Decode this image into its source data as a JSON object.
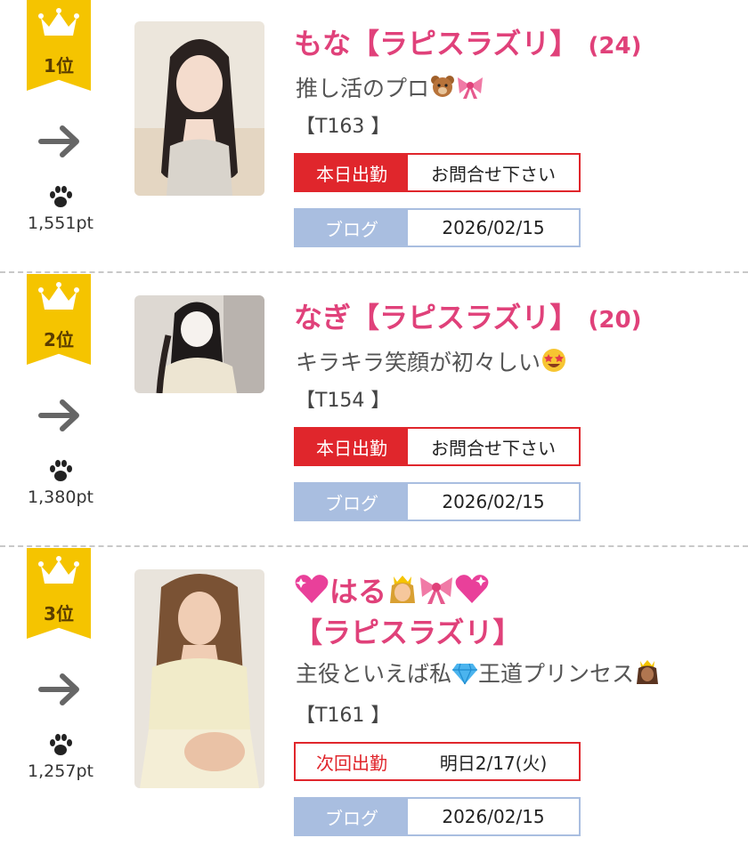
{
  "ranking": [
    {
      "rank_label": "1位",
      "points": "1,551pt",
      "name": "もな【ラピスラズリ】",
      "age": "(24)",
      "catchphrase": "推し活のプロ",
      "height": "【T163 】",
      "work_label": "本日出勤",
      "work_value": "お問合せ下さい",
      "blog_label": "ブログ",
      "blog_date": "2026/02/15"
    },
    {
      "rank_label": "2位",
      "points": "1,380pt",
      "name": "なぎ【ラピスラズリ】",
      "age": "(20)",
      "catchphrase": "キラキラ笑顔が初々しい",
      "height": "【T154 】",
      "work_label": "本日出勤",
      "work_value": "お問合せ下さい",
      "blog_label": "ブログ",
      "blog_date": "2026/02/15"
    },
    {
      "rank_label": "3位",
      "points": "1,257pt",
      "name_main": "はる",
      "name_shop": "【ラピスラズリ】",
      "catchphrase": "主役といえば私",
      "catchphrase_tail": "王道プリンセス",
      "height": "【T161 】",
      "work_label": "次回出勤",
      "work_value": "明日2/17(火)",
      "blog_label": "ブログ",
      "blog_date": "2026/02/15"
    }
  ],
  "colors": {
    "badge": "#f5c400",
    "name": "#e0417a",
    "work_today": "#e0262c",
    "blog": "#a9bee0"
  },
  "icons": [
    "crown-icon",
    "trend-arrow-icon",
    "paw-icon",
    "bear-emoji",
    "ribbon-emoji",
    "star-eyes-emoji",
    "sparkling-heart-emoji",
    "princess-emoji",
    "gem-emoji"
  ]
}
